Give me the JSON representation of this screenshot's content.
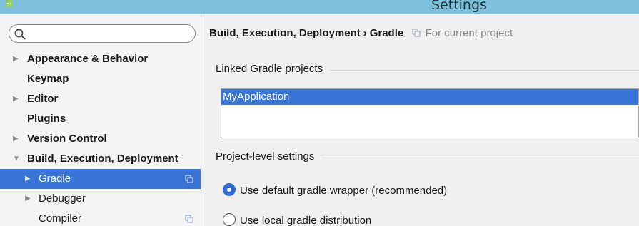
{
  "window": {
    "title": "Settings"
  },
  "sidebar": {
    "search": {
      "value": "",
      "placeholder": ""
    },
    "items": [
      {
        "label": "Appearance & Behavior",
        "expander": "▶"
      },
      {
        "label": "Keymap",
        "expander": ""
      },
      {
        "label": "Editor",
        "expander": "▶"
      },
      {
        "label": "Plugins",
        "expander": ""
      },
      {
        "label": "Version Control",
        "expander": "▶"
      },
      {
        "label": "Build, Execution, Deployment",
        "expander": "▼"
      },
      {
        "label": "Gradle",
        "expander": "▶"
      },
      {
        "label": "Debugger",
        "expander": "▶"
      },
      {
        "label": "Compiler",
        "expander": ""
      }
    ]
  },
  "content": {
    "breadcrumb": {
      "parent": "Build, Execution, Deployment",
      "separator": "›",
      "current": "Gradle",
      "scope": "For current project"
    },
    "linked_projects": {
      "legend": "Linked Gradle projects",
      "items": [
        "MyApplication"
      ]
    },
    "project_settings": {
      "legend": "Project-level settings",
      "options": [
        {
          "label": "Use default gradle wrapper (recommended)",
          "checked": true
        },
        {
          "label": "Use local gradle distribution",
          "checked": false
        }
      ]
    }
  },
  "colors": {
    "selection": "#3875d7",
    "titlebar": "#7ec0db",
    "radio": "#2d6ad1"
  },
  "icons": [
    "android-icon",
    "search-icon",
    "project-scope-icon"
  ]
}
